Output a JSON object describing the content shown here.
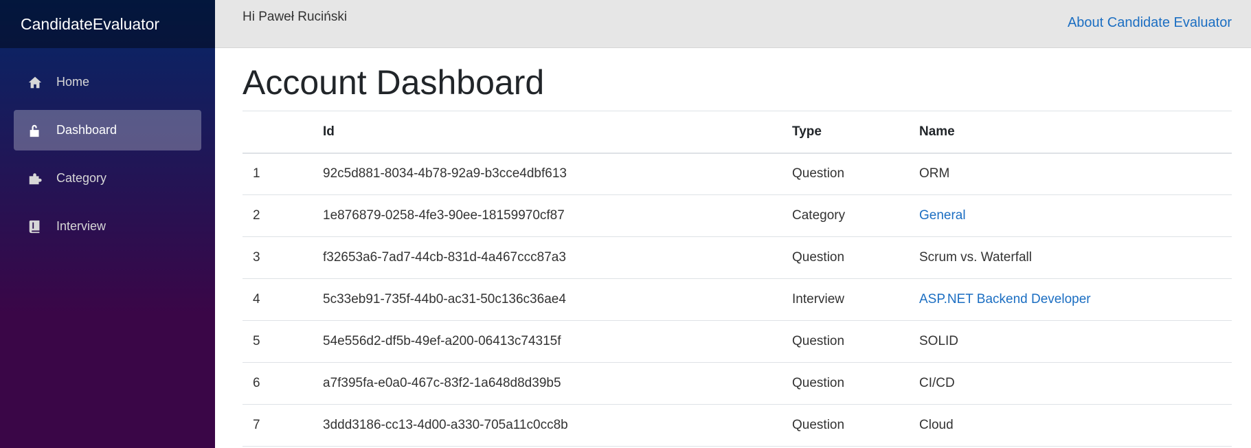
{
  "brand": {
    "title": "CandidateEvaluator"
  },
  "sidebar": {
    "items": [
      {
        "label": "Home",
        "icon": "home-icon",
        "active": false
      },
      {
        "label": "Dashboard",
        "icon": "unlocked-padlock-icon",
        "active": true
      },
      {
        "label": "Category",
        "icon": "puzzle-piece-icon",
        "active": false
      },
      {
        "label": "Interview",
        "icon": "book-icon",
        "active": false
      }
    ]
  },
  "topbar": {
    "greeting": "Hi Paweł Ruciński",
    "about_link": "About Candidate Evaluator"
  },
  "main": {
    "title": "Account Dashboard",
    "table": {
      "headers": [
        "",
        "Id",
        "Type",
        "Name"
      ],
      "rows": [
        {
          "num": "1",
          "id": "92c5d881-8034-4b78-92a9-b3cce4dbf613",
          "type": "Question",
          "name": "ORM",
          "link": false
        },
        {
          "num": "2",
          "id": "1e876879-0258-4fe3-90ee-18159970cf87",
          "type": "Category",
          "name": "General",
          "link": true
        },
        {
          "num": "3",
          "id": "f32653a6-7ad7-44cb-831d-4a467ccc87a3",
          "type": "Question",
          "name": "Scrum vs. Waterfall",
          "link": false
        },
        {
          "num": "4",
          "id": "5c33eb91-735f-44b0-ac31-50c136c36ae4",
          "type": "Interview",
          "name": "ASP.NET Backend Developer",
          "link": true
        },
        {
          "num": "5",
          "id": "54e556d2-df5b-49ef-a200-06413c74315f",
          "type": "Question",
          "name": "SOLID",
          "link": false
        },
        {
          "num": "6",
          "id": "a7f395fa-e0a0-467c-83f2-1a648d8d39b5",
          "type": "Question",
          "name": "CI/CD",
          "link": false
        },
        {
          "num": "7",
          "id": "3ddd3186-cc13-4d00-a330-705a11c0cc8b",
          "type": "Question",
          "name": "Cloud",
          "link": false
        }
      ]
    }
  },
  "colors": {
    "link": "#1b6ec2",
    "sidebar_top": "#052767",
    "sidebar_bottom": "#3a0647",
    "topbar_bg": "#e6e6e6"
  }
}
